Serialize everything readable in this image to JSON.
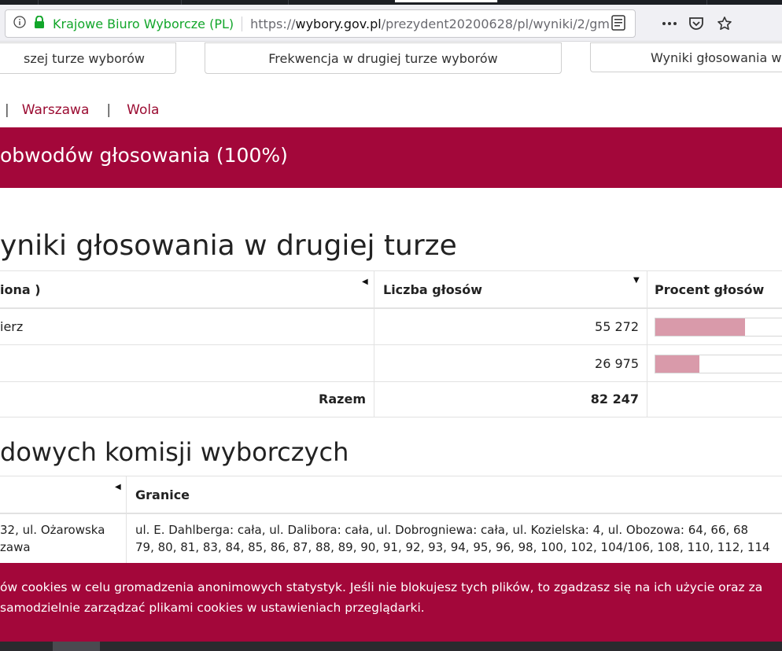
{
  "browser": {
    "site_identity": "Krajowe Biuro Wyborcze (PL)",
    "url_prefix": "https://",
    "url_domain": "wybory.gov.pl",
    "url_path": "/prezydent20200628/pl/wyniki/2/gm"
  },
  "nav_tabs": [
    {
      "label": "szej turze wyborów"
    },
    {
      "label": "Frekwencja w drugiej turze wyborów"
    },
    {
      "label": "Wyniki głosowania w"
    }
  ],
  "breadcrumb": {
    "separator": "|",
    "items": [
      "Warszawa",
      "Wola"
    ]
  },
  "banner": {
    "text": "obwodów głosowania (100%)"
  },
  "results": {
    "heading": "yniki głosowania w drugiej turze",
    "columns": [
      "iona )",
      "Liczba głosów",
      "Procent głosów"
    ],
    "rows": [
      {
        "name": "ierz",
        "votes": "55 272",
        "share": 0.672
      },
      {
        "name": "",
        "votes": "26 975",
        "share": 0.328
      }
    ],
    "total_label": "Razem",
    "total_votes": "82 247"
  },
  "commissions": {
    "heading": "dowych komisji wyborczych",
    "columns": [
      "",
      "Granice"
    ],
    "rows": [
      {
        "address_line1": "32, ul. Ożarowska",
        "address_line2": "zawa",
        "boundary_line1": "ul. E. Dahlberga: cała, ul. Dalibora: cała, ul. Dobrogniewa: cała, ul. Kozielska: 4, ul. Obozowa: 64, 66, 68",
        "boundary_line2": "79, 80, 81, 83, 84, 85, 86, 87, 88, 89, 90, 91, 92, 93, 94, 95, 96, 98, 100, 102, 104/106, 108, 110, 112, 114"
      }
    ]
  },
  "cookie": {
    "line1": "ów cookies w celu gromadzenia anonimowych statystyk. Jeśli nie blokujesz tych plików, to zgadzasz się na ich użycie oraz za",
    "line2": " samodzielnie zarządzać plikami cookies w ustawieniach przeglądarki."
  },
  "colors": {
    "accent": "#a3073a",
    "bar": "#d99aaa",
    "link": "#9b0c32",
    "secure_green": "#12a62a"
  },
  "icons": [
    "info-icon",
    "lock-icon",
    "reader-view-icon",
    "more-icon",
    "pocket-icon",
    "bookmark-star-icon",
    "sort-left-icon",
    "sort-down-icon"
  ]
}
